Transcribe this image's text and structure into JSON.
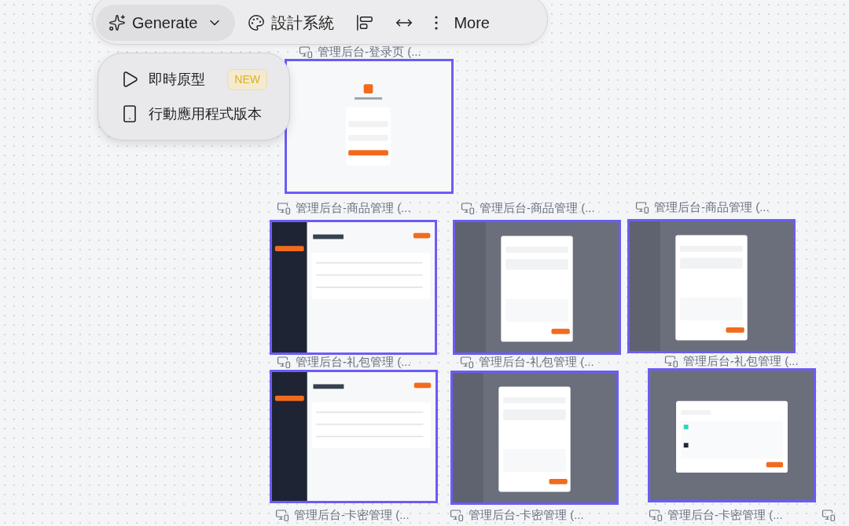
{
  "toolbar": {
    "items": [
      {
        "kind": "generate",
        "label": "Generate",
        "selected": true
      },
      {
        "kind": "palette",
        "label": "設計系統",
        "selected": false
      },
      {
        "kind": "align",
        "selected": false
      },
      {
        "kind": "spacing",
        "selected": false
      },
      {
        "kind": "more",
        "label": "More",
        "selected": false
      }
    ]
  },
  "menu": {
    "items": [
      {
        "kind": "play",
        "label": "即時原型",
        "badge": "NEW"
      },
      {
        "kind": "phone",
        "label": "行動應用程式版本"
      }
    ]
  },
  "frames": [
    {
      "label": "管理后台-登录页 (...",
      "kind": "login"
    },
    {
      "label": "管理后台-商品管理 (...",
      "kind": "list"
    },
    {
      "label": "管理后台-商品管理 (...",
      "kind": "modal"
    },
    {
      "label": "管理后台-商品管理 (...",
      "kind": "modal"
    },
    {
      "label": "管理后台-礼包管理 (...",
      "kind": "list"
    },
    {
      "label": "管理后台-礼包管理 (...",
      "kind": "modal"
    },
    {
      "label": "管理后台-礼包管理 (...",
      "kind": "picker"
    },
    {
      "label": "管理后台-卡密管理 (...",
      "kind": "offscreen"
    },
    {
      "label": "管理后台-卡密管理 (...",
      "kind": "offscreen"
    },
    {
      "label": "管理后台-卡密管理 (...",
      "kind": "offscreen"
    },
    {
      "kind": "offscreen"
    }
  ]
}
